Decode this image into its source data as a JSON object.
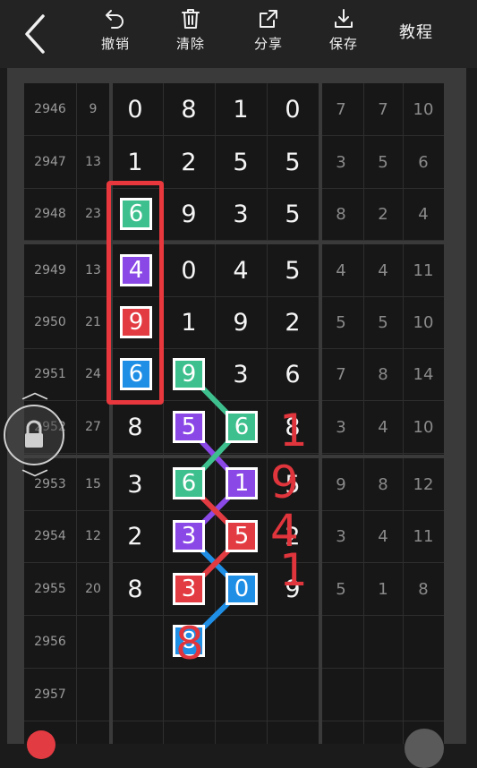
{
  "toolbar": {
    "undo_label": "撤销",
    "clear_label": "清除",
    "share_label": "分享",
    "save_label": "保存",
    "tutorial_label": "教程"
  },
  "table": {
    "rows": [
      {
        "issue": "2946",
        "sum": "9",
        "digits": [
          "0",
          "8",
          "1",
          "0"
        ],
        "stats": [
          "7",
          "7",
          "10"
        ]
      },
      {
        "issue": "2947",
        "sum": "13",
        "digits": [
          "1",
          "2",
          "5",
          "5"
        ],
        "stats": [
          "3",
          "5",
          "6"
        ]
      },
      {
        "issue": "2948",
        "sum": "23",
        "digits": [
          "6",
          "9",
          "3",
          "5"
        ],
        "stats": [
          "8",
          "2",
          "4"
        ]
      },
      {
        "issue": "2949",
        "sum": "13",
        "digits": [
          "4",
          "0",
          "4",
          "5"
        ],
        "stats": [
          "4",
          "4",
          "11"
        ]
      },
      {
        "issue": "2950",
        "sum": "21",
        "digits": [
          "9",
          "1",
          "9",
          "2"
        ],
        "stats": [
          "5",
          "5",
          "10"
        ]
      },
      {
        "issue": "2951",
        "sum": "24",
        "digits": [
          "6",
          "9",
          "3",
          "6"
        ],
        "stats": [
          "7",
          "8",
          "14"
        ]
      },
      {
        "issue": "2952",
        "sum": "27",
        "digits": [
          "8",
          "5",
          "6",
          "8"
        ],
        "stats": [
          "3",
          "4",
          "10"
        ]
      },
      {
        "issue": "2953",
        "sum": "15",
        "digits": [
          "3",
          "6",
          "1",
          "5"
        ],
        "stats": [
          "9",
          "8",
          "12"
        ]
      },
      {
        "issue": "2954",
        "sum": "12",
        "digits": [
          "2",
          "3",
          "5",
          "2"
        ],
        "stats": [
          "3",
          "4",
          "11"
        ]
      },
      {
        "issue": "2955",
        "sum": "20",
        "digits": [
          "8",
          "3",
          "0",
          "9"
        ],
        "stats": [
          "5",
          "1",
          "8"
        ]
      },
      {
        "issue": "2956",
        "sum": "",
        "digits": [
          "",
          "8",
          "",
          ""
        ],
        "stats": [
          "",
          "",
          ""
        ]
      },
      {
        "issue": "2957",
        "sum": "",
        "digits": [
          "",
          "",
          "",
          ""
        ],
        "stats": [
          "",
          "",
          ""
        ]
      }
    ]
  },
  "annotations": {
    "handwritten": [
      "1",
      "9",
      "4",
      "1",
      "8"
    ]
  },
  "colors": {
    "green": "#3ec08e",
    "purple": "#8a48e6",
    "red": "#e33b42",
    "blue": "#1f8fe6",
    "highlight_frame": "#e8383d"
  },
  "icons": {
    "back": "chevron-left-icon",
    "undo": "undo-arrow-icon",
    "clear": "trash-icon",
    "share": "share-icon",
    "save": "download-icon",
    "lock": "lock-icon"
  }
}
